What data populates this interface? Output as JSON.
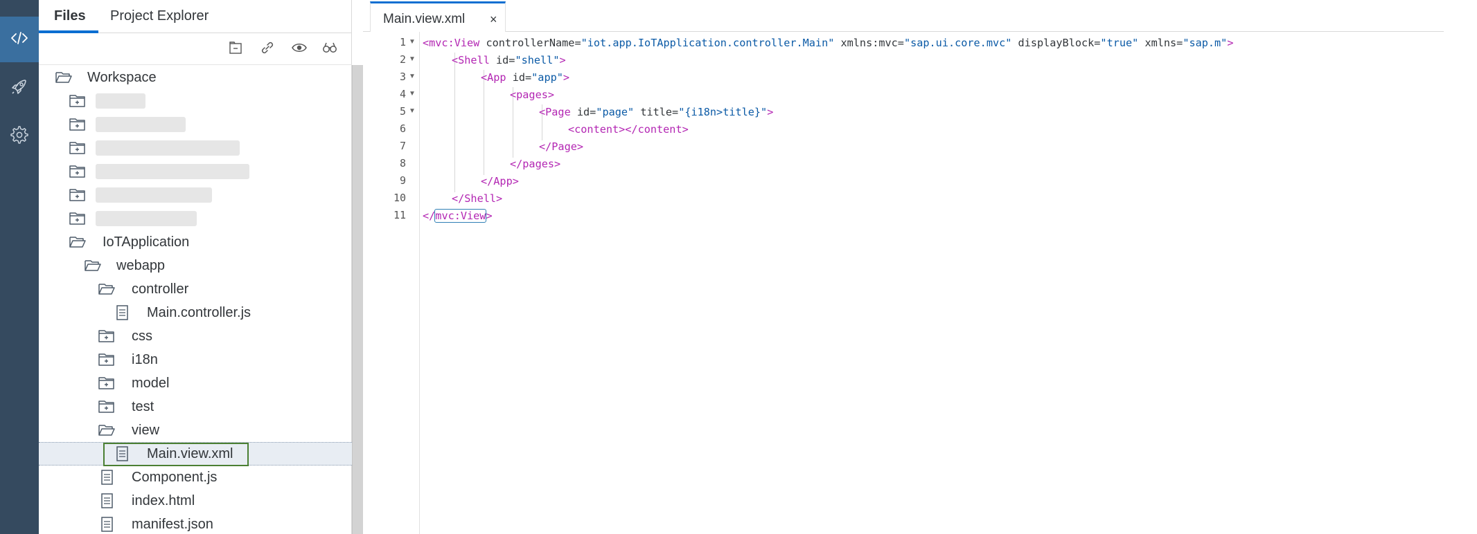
{
  "sidebar_tabs": {
    "files": "Files",
    "project_explorer": "Project Explorer"
  },
  "tree": {
    "workspace": "Workspace",
    "project": "IoTApplication",
    "webapp": "webapp",
    "controller": "controller",
    "main_controller": "Main.controller.js",
    "css": "css",
    "i18n": "i18n",
    "model": "model",
    "test": "test",
    "view": "view",
    "main_view": "Main.view.xml",
    "component": "Component.js",
    "index": "index.html",
    "manifest": "manifest.json"
  },
  "editor": {
    "tab_name": "Main.view.xml",
    "close_glyph": "×",
    "line_numbers": [
      "1",
      "2",
      "3",
      "4",
      "5",
      "6",
      "7",
      "8",
      "9",
      "10",
      "11"
    ],
    "code": {
      "l1_open": "<mvc:View",
      "l1_a1": " controllerName=",
      "l1_v1": "\"iot.app.IoTApplication.controller.Main\"",
      "l1_a2": " xmlns:mvc=",
      "l1_v2": "\"sap.ui.core.mvc\"",
      "l1_a3": " displayBlock=",
      "l1_v3": "\"true\"",
      "l1_a4": " xmlns=",
      "l1_v4": "\"sap.m\"",
      "l1_close": ">",
      "l2_open": "<Shell",
      "l2_a1": " id=",
      "l2_v1": "\"shell\"",
      "l2_close": ">",
      "l3_open": "<App",
      "l3_a1": " id=",
      "l3_v1": "\"app\"",
      "l3_close": ">",
      "l4": "<pages>",
      "l5_open": "<Page",
      "l5_a1": " id=",
      "l5_v1": "\"page\"",
      "l5_a2": " title=",
      "l5_v2": "\"{i18n>title}\"",
      "l5_close": ">",
      "l6": "<content></content>",
      "l7": "</Page>",
      "l8": "</pages>",
      "l9": "</App>",
      "l10": "</Shell>",
      "l11_open": "</",
      "l11_name": "mvc:View",
      "l11_close": ">"
    }
  },
  "colors": {
    "activity_bar": "#354a5f",
    "active_item": "#3a6f9f",
    "accent": "#0a6ed1",
    "selection_border": "#4a7f32",
    "xml_tag": "#b326b3",
    "xml_string": "#0b5aa6"
  },
  "icons": {
    "activity": [
      "code-icon",
      "rocket-icon",
      "gear-icon"
    ],
    "toolbar": [
      "collapse-all-icon",
      "link-icon",
      "show-hidden-icon",
      "search-icon"
    ],
    "tree": [
      "folder-open-icon",
      "folder-closed-icon",
      "file-icon"
    ]
  }
}
